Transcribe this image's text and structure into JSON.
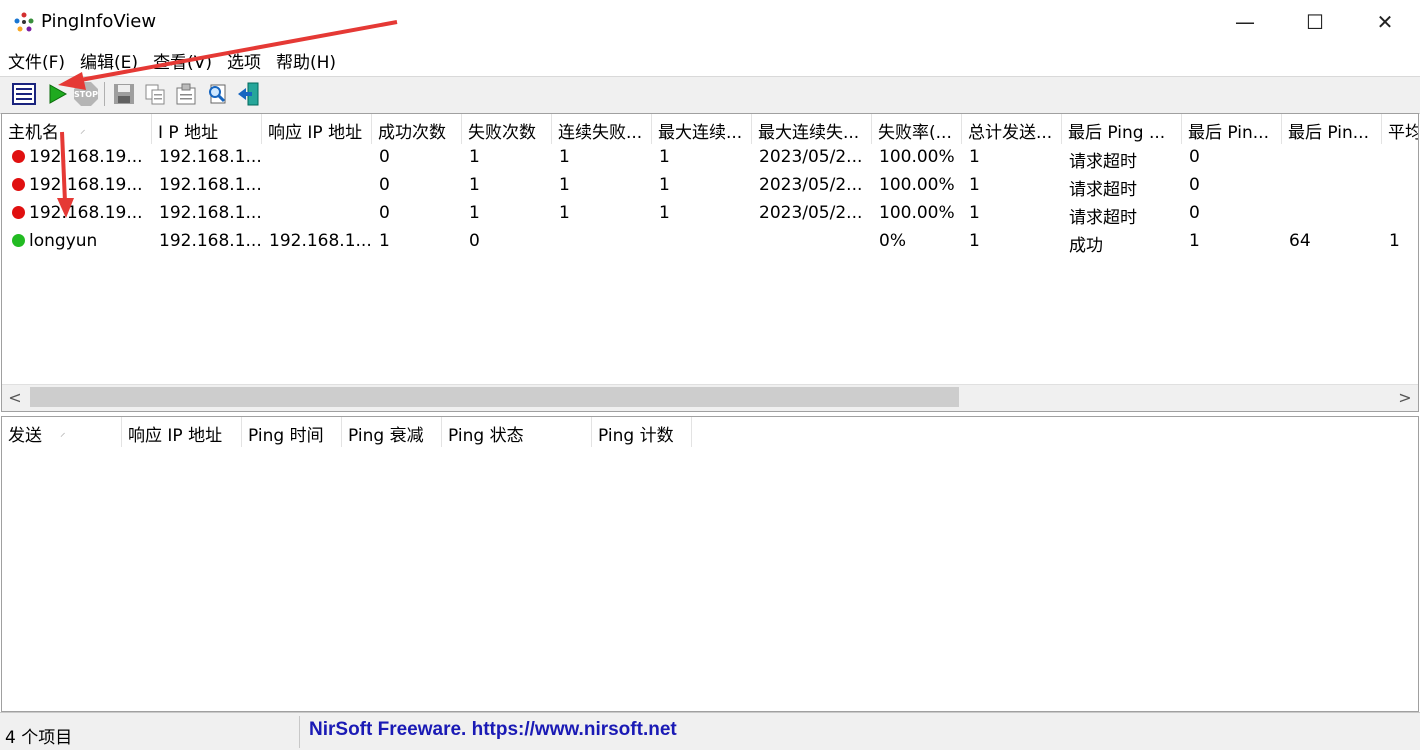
{
  "window": {
    "title": "PingInfoView",
    "min_glyph": "—",
    "max_glyph": "☐",
    "close_glyph": "✕"
  },
  "menu": [
    "文件(F)",
    "编辑(E)",
    "查看(V)",
    "选项",
    "帮助(H)"
  ],
  "toolbar": {
    "buttons": [
      "list-icon",
      "start-icon",
      "stop-icon",
      "save-icon",
      "copy-icon",
      "properties-icon",
      "find-icon",
      "exit-icon"
    ]
  },
  "top_table": {
    "columns": [
      "主机名",
      "I P 地址",
      "响应 IP 地址",
      "成功次数",
      "失败次数",
      "连续失败...",
      "最大连续...",
      "最大连续失...",
      "失败率(...",
      "总计发送...",
      "最后 Ping ...",
      "最后 Pin...",
      "最后 Pin...",
      "平均"
    ],
    "rows": [
      {
        "status": "fail",
        "cells": [
          "192.168.19...",
          "192.168.1...",
          "",
          "0",
          "1",
          "1",
          "1",
          "2023/05/2...",
          "100.00%",
          "1",
          "请求超时",
          "0",
          "",
          ""
        ]
      },
      {
        "status": "fail",
        "cells": [
          "192.168.19...",
          "192.168.1...",
          "",
          "0",
          "1",
          "1",
          "1",
          "2023/05/2...",
          "100.00%",
          "1",
          "请求超时",
          "0",
          "",
          ""
        ]
      },
      {
        "status": "fail",
        "cells": [
          "192.168.19...",
          "192.168.1...",
          "",
          "0",
          "1",
          "1",
          "1",
          "2023/05/2...",
          "100.00%",
          "1",
          "请求超时",
          "0",
          "",
          ""
        ]
      },
      {
        "status": "ok",
        "cells": [
          "longyun",
          "192.168.1...",
          "192.168.1...",
          "1",
          "0",
          "",
          "",
          "",
          "0%",
          "1",
          "成功",
          "1",
          "64",
          "1"
        ]
      }
    ],
    "scroll_left": "<",
    "scroll_right": ">"
  },
  "bottom_table": {
    "columns": [
      "发送",
      "响应 IP 地址",
      "Ping 时间",
      "Ping 衰减",
      "Ping 状态",
      "Ping 计数"
    ]
  },
  "status": {
    "item_count": "4 个项目",
    "link": "NirSoft Freeware. https://www.nirsoft.net"
  },
  "colors": {
    "fail_dot": "#e01010",
    "ok_dot": "#22bb22",
    "link": "#1a1ab5",
    "annotation_arrow": "#e53935"
  }
}
